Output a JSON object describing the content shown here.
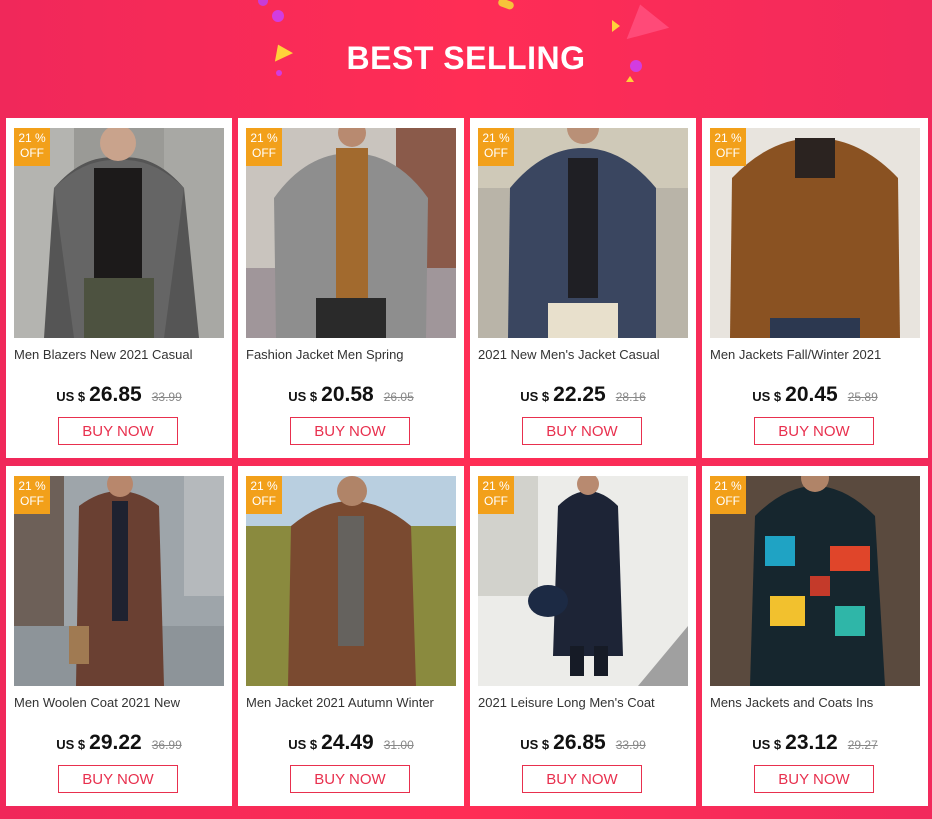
{
  "header": {
    "title": "BEST SELLING"
  },
  "currency": "US $",
  "products": [
    {
      "badge_pct": "21 %",
      "badge_off": "OFF",
      "title": "Men Blazers New 2021 Casual",
      "price": "26.85",
      "old_price": "33.99",
      "button": "BUY NOW"
    },
    {
      "badge_pct": "21 %",
      "badge_off": "OFF",
      "title": "Fashion Jacket Men Spring",
      "price": "20.58",
      "old_price": "26.05",
      "button": "BUY NOW"
    },
    {
      "badge_pct": "21 %",
      "badge_off": "OFF",
      "title": "2021 New Men's Jacket Casual",
      "price": "22.25",
      "old_price": "28.16",
      "button": "BUY NOW"
    },
    {
      "badge_pct": "21 %",
      "badge_off": "OFF",
      "title": "Men Jackets Fall/Winter 2021",
      "price": "20.45",
      "old_price": "25.89",
      "button": "BUY NOW"
    },
    {
      "badge_pct": "21 %",
      "badge_off": "OFF",
      "title": "Men Woolen Coat 2021 New",
      "price": "29.22",
      "old_price": "36.99",
      "button": "BUY NOW"
    },
    {
      "badge_pct": "21 %",
      "badge_off": "OFF",
      "title": "Men Jacket 2021 Autumn Winter",
      "price": "24.49",
      "old_price": "31.00",
      "button": "BUY NOW"
    },
    {
      "badge_pct": "21 %",
      "badge_off": "OFF",
      "title": "2021 Leisure Long Men's Coat",
      "price": "26.85",
      "old_price": "33.99",
      "button": "BUY NOW"
    },
    {
      "badge_pct": "21 %",
      "badge_off": "OFF",
      "title": "Mens Jackets and Coats Ins",
      "price": "23.12",
      "old_price": "29.27",
      "button": "BUY NOW"
    }
  ],
  "colors": {
    "accent": "#e8304e",
    "badge": "#f2a01a",
    "background": "#ff2d55"
  }
}
